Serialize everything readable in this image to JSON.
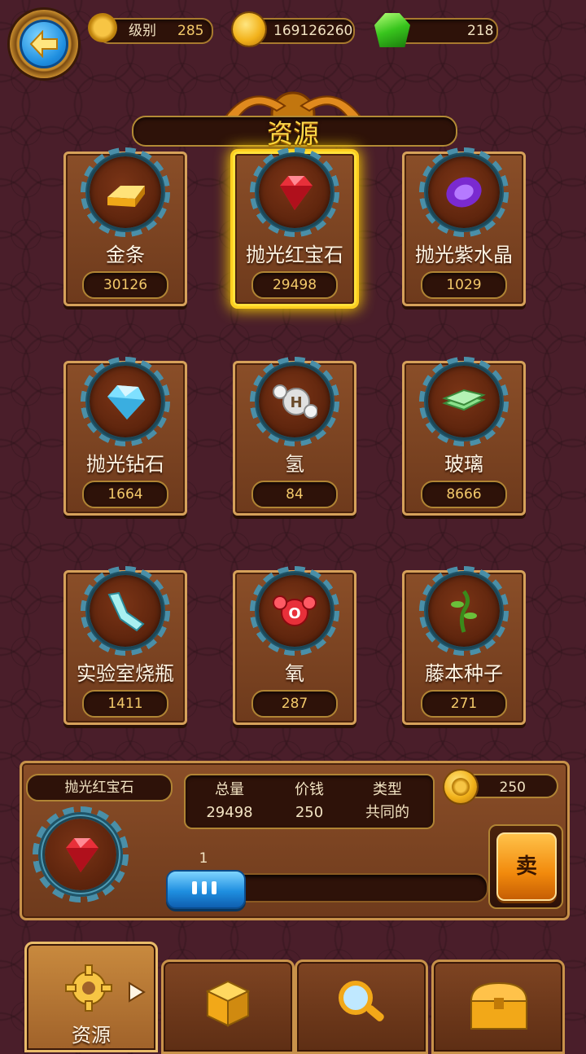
{
  "header": {
    "level_label": "级别",
    "level_value": "285",
    "coins": "169126260",
    "gems": "218",
    "icons": [
      "back-arrow-icon",
      "gear-icon",
      "gold-coin-icon",
      "green-gem-icon"
    ]
  },
  "title": "资源",
  "resources": [
    {
      "name": "金条",
      "count": "30126",
      "icon": "gold-bar-icon"
    },
    {
      "name": "抛光红宝石",
      "count": "29498",
      "icon": "ruby-icon",
      "selected": true
    },
    {
      "name": "抛光紫水晶",
      "count": "1029",
      "icon": "amethyst-icon"
    },
    {
      "name": "抛光钻石",
      "count": "1664",
      "icon": "diamond-icon"
    },
    {
      "name": "氢",
      "count": "84",
      "icon": "hydrogen-molecule-icon"
    },
    {
      "name": "玻璃",
      "count": "8666",
      "icon": "glass-panes-icon"
    },
    {
      "name": "实验室烧瓶",
      "count": "1411",
      "icon": "lab-flask-icon"
    },
    {
      "name": "氧",
      "count": "287",
      "icon": "oxygen-molecule-icon"
    },
    {
      "name": "藤本种子",
      "count": "271",
      "icon": "vine-seed-icon"
    }
  ],
  "detail": {
    "name": "抛光红宝石",
    "total_label": "总量",
    "total_value": "29498",
    "price_label": "价钱",
    "price_value": "250",
    "type_label": "类型",
    "type_value": "共同的",
    "sell_price": "250",
    "quantity": "1",
    "sell_label": "卖"
  },
  "tabs": [
    {
      "label": "资源",
      "icon": "gear-icon",
      "active": true
    },
    {
      "label": "",
      "icon": "dice-box-icon"
    },
    {
      "label": "",
      "icon": "magnifier-icon"
    },
    {
      "label": "",
      "icon": "treasure-chest-icon"
    }
  ],
  "colors": {
    "background": "#4a1e2a",
    "card": "#7a4422",
    "highlight": "#ffe23a",
    "accent_blue": "#1f8fe0",
    "sell_orange": "#f28a0c"
  }
}
